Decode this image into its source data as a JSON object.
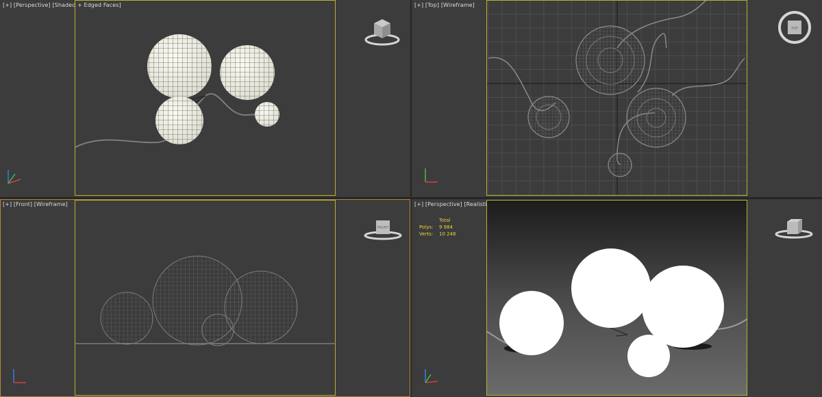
{
  "viewports": {
    "top_left": {
      "label_plus": "[+]",
      "label_view": "[Perspective]",
      "label_shading": "[Shaded + Edged Faces]"
    },
    "top_right": {
      "label_plus": "[+]",
      "label_view": "[Top]",
      "label_shading": "[Wireframe]"
    },
    "bottom_left": {
      "label_plus": "[+]",
      "label_view": "[Front]",
      "label_shading": "[Wireframe]"
    },
    "bottom_right": {
      "label_plus": "[+]",
      "label_view": "[Perspective]",
      "label_shading": "[Realistic]",
      "stats": {
        "header": "Total",
        "polys_label": "Polys:",
        "polys_value": "9 984",
        "verts_label": "Verts:",
        "verts_value": "10 248"
      }
    }
  },
  "viewcube_labels": {
    "top": "TOP",
    "front": "FRONT"
  },
  "colors": {
    "viewport_bg": "#3c3c3c",
    "safe_frame": "#b8b230",
    "active_border": "#b9863c",
    "stats_text": "#e8d23c",
    "wire": "#8a8a8a",
    "grid": "#5b5b5b"
  }
}
